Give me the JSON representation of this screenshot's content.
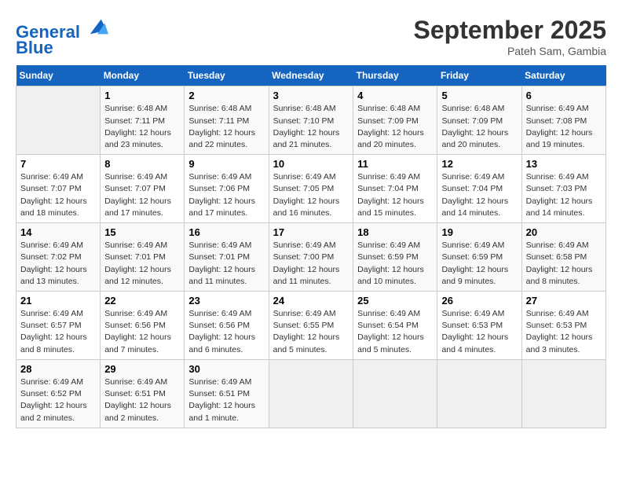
{
  "header": {
    "logo_line1": "General",
    "logo_line2": "Blue",
    "month": "September 2025",
    "location": "Pateh Sam, Gambia"
  },
  "days_of_week": [
    "Sunday",
    "Monday",
    "Tuesday",
    "Wednesday",
    "Thursday",
    "Friday",
    "Saturday"
  ],
  "weeks": [
    [
      {
        "num": "",
        "info": ""
      },
      {
        "num": "1",
        "info": "Sunrise: 6:48 AM\nSunset: 7:11 PM\nDaylight: 12 hours\nand 23 minutes."
      },
      {
        "num": "2",
        "info": "Sunrise: 6:48 AM\nSunset: 7:11 PM\nDaylight: 12 hours\nand 22 minutes."
      },
      {
        "num": "3",
        "info": "Sunrise: 6:48 AM\nSunset: 7:10 PM\nDaylight: 12 hours\nand 21 minutes."
      },
      {
        "num": "4",
        "info": "Sunrise: 6:48 AM\nSunset: 7:09 PM\nDaylight: 12 hours\nand 20 minutes."
      },
      {
        "num": "5",
        "info": "Sunrise: 6:48 AM\nSunset: 7:09 PM\nDaylight: 12 hours\nand 20 minutes."
      },
      {
        "num": "6",
        "info": "Sunrise: 6:49 AM\nSunset: 7:08 PM\nDaylight: 12 hours\nand 19 minutes."
      }
    ],
    [
      {
        "num": "7",
        "info": "Sunrise: 6:49 AM\nSunset: 7:07 PM\nDaylight: 12 hours\nand 18 minutes."
      },
      {
        "num": "8",
        "info": "Sunrise: 6:49 AM\nSunset: 7:07 PM\nDaylight: 12 hours\nand 17 minutes."
      },
      {
        "num": "9",
        "info": "Sunrise: 6:49 AM\nSunset: 7:06 PM\nDaylight: 12 hours\nand 17 minutes."
      },
      {
        "num": "10",
        "info": "Sunrise: 6:49 AM\nSunset: 7:05 PM\nDaylight: 12 hours\nand 16 minutes."
      },
      {
        "num": "11",
        "info": "Sunrise: 6:49 AM\nSunset: 7:04 PM\nDaylight: 12 hours\nand 15 minutes."
      },
      {
        "num": "12",
        "info": "Sunrise: 6:49 AM\nSunset: 7:04 PM\nDaylight: 12 hours\nand 14 minutes."
      },
      {
        "num": "13",
        "info": "Sunrise: 6:49 AM\nSunset: 7:03 PM\nDaylight: 12 hours\nand 14 minutes."
      }
    ],
    [
      {
        "num": "14",
        "info": "Sunrise: 6:49 AM\nSunset: 7:02 PM\nDaylight: 12 hours\nand 13 minutes."
      },
      {
        "num": "15",
        "info": "Sunrise: 6:49 AM\nSunset: 7:01 PM\nDaylight: 12 hours\nand 12 minutes."
      },
      {
        "num": "16",
        "info": "Sunrise: 6:49 AM\nSunset: 7:01 PM\nDaylight: 12 hours\nand 11 minutes."
      },
      {
        "num": "17",
        "info": "Sunrise: 6:49 AM\nSunset: 7:00 PM\nDaylight: 12 hours\nand 11 minutes."
      },
      {
        "num": "18",
        "info": "Sunrise: 6:49 AM\nSunset: 6:59 PM\nDaylight: 12 hours\nand 10 minutes."
      },
      {
        "num": "19",
        "info": "Sunrise: 6:49 AM\nSunset: 6:59 PM\nDaylight: 12 hours\nand 9 minutes."
      },
      {
        "num": "20",
        "info": "Sunrise: 6:49 AM\nSunset: 6:58 PM\nDaylight: 12 hours\nand 8 minutes."
      }
    ],
    [
      {
        "num": "21",
        "info": "Sunrise: 6:49 AM\nSunset: 6:57 PM\nDaylight: 12 hours\nand 8 minutes."
      },
      {
        "num": "22",
        "info": "Sunrise: 6:49 AM\nSunset: 6:56 PM\nDaylight: 12 hours\nand 7 minutes."
      },
      {
        "num": "23",
        "info": "Sunrise: 6:49 AM\nSunset: 6:56 PM\nDaylight: 12 hours\nand 6 minutes."
      },
      {
        "num": "24",
        "info": "Sunrise: 6:49 AM\nSunset: 6:55 PM\nDaylight: 12 hours\nand 5 minutes."
      },
      {
        "num": "25",
        "info": "Sunrise: 6:49 AM\nSunset: 6:54 PM\nDaylight: 12 hours\nand 5 minutes."
      },
      {
        "num": "26",
        "info": "Sunrise: 6:49 AM\nSunset: 6:53 PM\nDaylight: 12 hours\nand 4 minutes."
      },
      {
        "num": "27",
        "info": "Sunrise: 6:49 AM\nSunset: 6:53 PM\nDaylight: 12 hours\nand 3 minutes."
      }
    ],
    [
      {
        "num": "28",
        "info": "Sunrise: 6:49 AM\nSunset: 6:52 PM\nDaylight: 12 hours\nand 2 minutes."
      },
      {
        "num": "29",
        "info": "Sunrise: 6:49 AM\nSunset: 6:51 PM\nDaylight: 12 hours\nand 2 minutes."
      },
      {
        "num": "30",
        "info": "Sunrise: 6:49 AM\nSunset: 6:51 PM\nDaylight: 12 hours\nand 1 minute."
      },
      {
        "num": "",
        "info": ""
      },
      {
        "num": "",
        "info": ""
      },
      {
        "num": "",
        "info": ""
      },
      {
        "num": "",
        "info": ""
      }
    ]
  ]
}
